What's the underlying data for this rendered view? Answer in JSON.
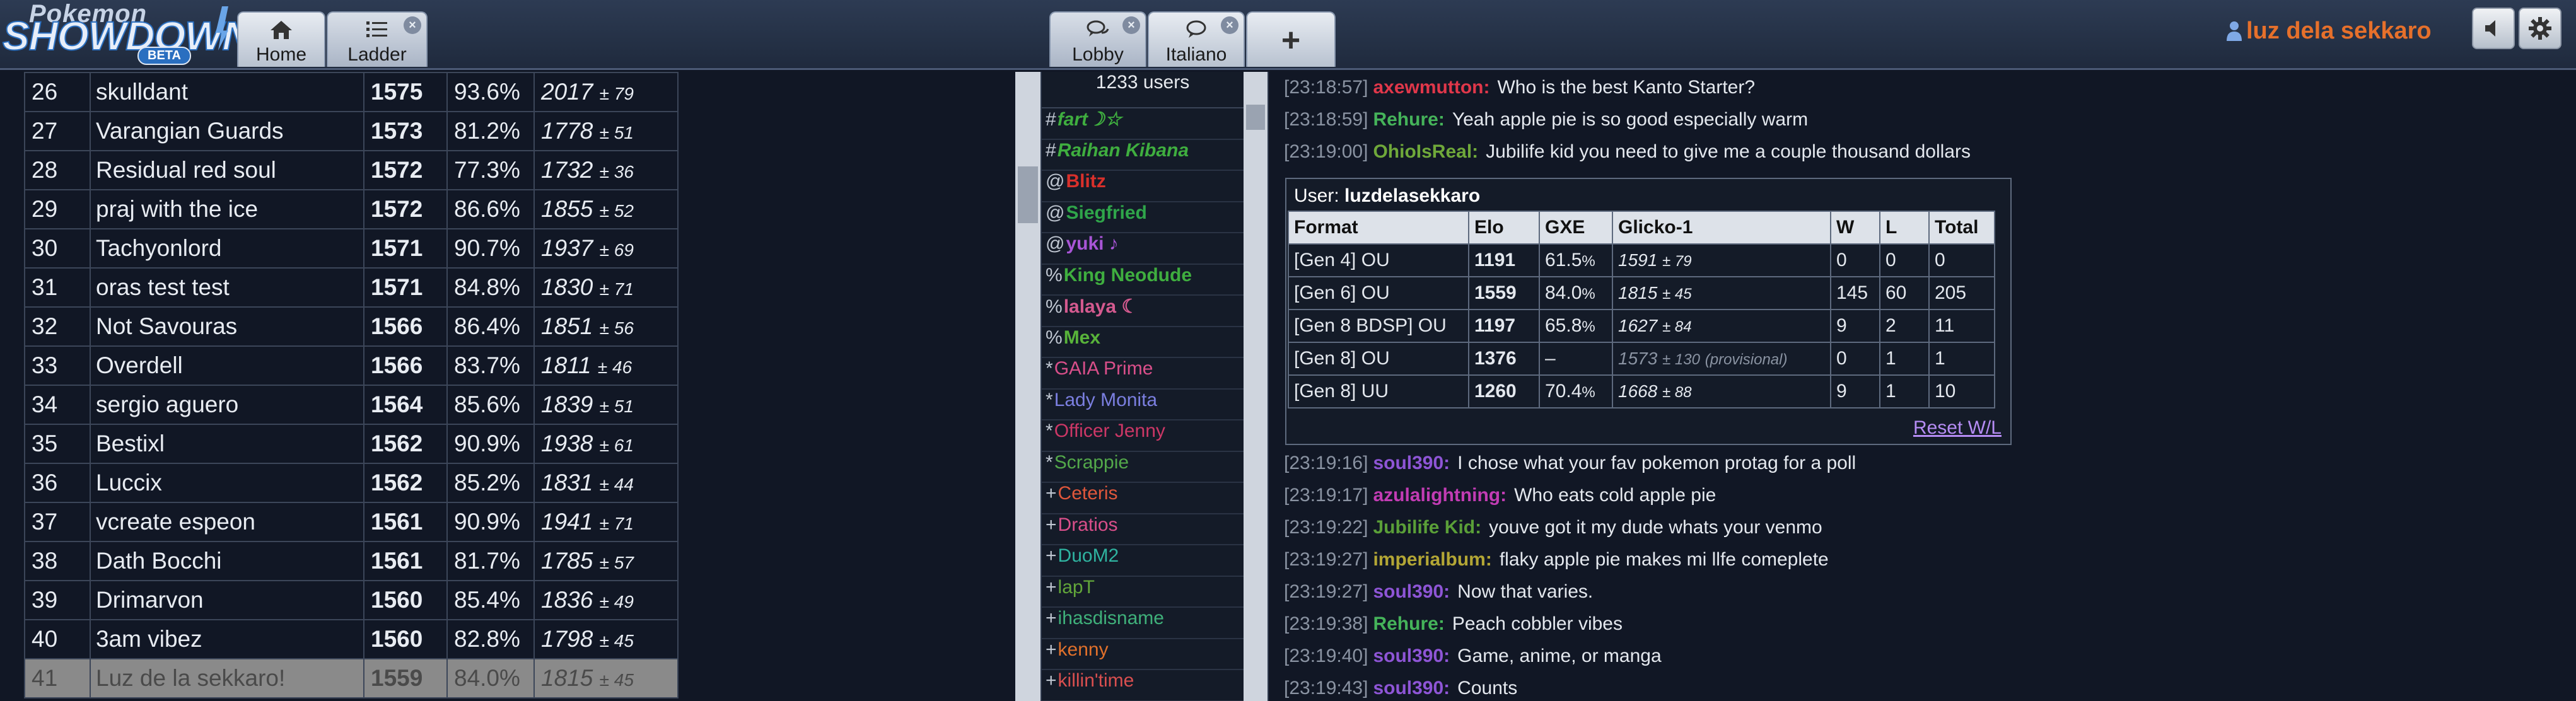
{
  "header": {
    "logo_top": "Pokemon",
    "logo_main": "SHOWDOWN",
    "logo_badge": "BETA",
    "tabs": [
      {
        "label": "Home",
        "icon": "home-icon"
      },
      {
        "label": "Ladder",
        "icon": "list-icon",
        "close": "×"
      },
      {
        "label": "Lobby",
        "icon": "chat-bubbles-icon",
        "close": "×"
      },
      {
        "label": "Italiano",
        "icon": "chat-bubble-icon",
        "close": "×"
      },
      {
        "label": "+",
        "icon": "plus-icon"
      }
    ],
    "username": "luz dela sekkaro"
  },
  "ladder": {
    "rows": [
      {
        "rank": "26",
        "name": "skulldant",
        "elo": "1575",
        "gxe": "93.6%",
        "glicko": "2017",
        "dev": "± 79"
      },
      {
        "rank": "27",
        "name": "Varangian Guards",
        "elo": "1573",
        "gxe": "81.2%",
        "glicko": "1778",
        "dev": "± 51"
      },
      {
        "rank": "28",
        "name": "Residual red soul",
        "elo": "1572",
        "gxe": "77.3%",
        "glicko": "1732",
        "dev": "± 36"
      },
      {
        "rank": "29",
        "name": "praj with the ice",
        "elo": "1572",
        "gxe": "86.6%",
        "glicko": "1855",
        "dev": "± 52"
      },
      {
        "rank": "30",
        "name": "Tachyonlord",
        "elo": "1571",
        "gxe": "90.7%",
        "glicko": "1937",
        "dev": "± 69"
      },
      {
        "rank": "31",
        "name": "oras test test",
        "elo": "1571",
        "gxe": "84.8%",
        "glicko": "1830",
        "dev": "± 71"
      },
      {
        "rank": "32",
        "name": "Not Savouras",
        "elo": "1566",
        "gxe": "86.4%",
        "glicko": "1851",
        "dev": "± 56"
      },
      {
        "rank": "33",
        "name": "Overdell",
        "elo": "1566",
        "gxe": "83.7%",
        "glicko": "1811",
        "dev": "± 46"
      },
      {
        "rank": "34",
        "name": "sergio aguero",
        "elo": "1564",
        "gxe": "85.6%",
        "glicko": "1839",
        "dev": "± 51"
      },
      {
        "rank": "35",
        "name": "Bestixl",
        "elo": "1562",
        "gxe": "90.9%",
        "glicko": "1938",
        "dev": "± 61"
      },
      {
        "rank": "36",
        "name": "Luccix",
        "elo": "1562",
        "gxe": "85.2%",
        "glicko": "1831",
        "dev": "± 44"
      },
      {
        "rank": "37",
        "name": "vcreate espeon",
        "elo": "1561",
        "gxe": "90.9%",
        "glicko": "1941",
        "dev": "± 71"
      },
      {
        "rank": "38",
        "name": "Dath Bocchi",
        "elo": "1561",
        "gxe": "81.7%",
        "glicko": "1785",
        "dev": "± 57"
      },
      {
        "rank": "39",
        "name": "Drimarvon",
        "elo": "1560",
        "gxe": "85.4%",
        "glicko": "1836",
        "dev": "± 49"
      },
      {
        "rank": "40",
        "name": "3am vibez",
        "elo": "1560",
        "gxe": "82.8%",
        "glicko": "1798",
        "dev": "± 45"
      },
      {
        "rank": "41",
        "name": "Luz de la sekkaro!",
        "elo": "1559",
        "gxe": "84.0%",
        "glicko": "1815",
        "dev": "± 45"
      }
    ]
  },
  "userlist": {
    "count": "1233 users",
    "users": [
      {
        "group": "#",
        "name": "fart☽☆",
        "color": "#3fae3f",
        "style": "auth"
      },
      {
        "group": "#",
        "name": "Raihan Kibana",
        "color": "#3fae3f",
        "style": "auth"
      },
      {
        "group": "@",
        "name": "Blitz",
        "color": "#d9302b",
        "style": "staff"
      },
      {
        "group": "@",
        "name": "Siegfried",
        "color": "#2fa54a",
        "style": "staff"
      },
      {
        "group": "@",
        "name": "yuki ♪",
        "color": "#a855d6",
        "style": "staff"
      },
      {
        "group": "%",
        "name": "King Neodude",
        "color": "#3fae3f",
        "style": "staff"
      },
      {
        "group": "%",
        "name": "lalaya ☾",
        "color": "#d45a8f",
        "style": "staff"
      },
      {
        "group": "%",
        "name": "Mex",
        "color": "#58b33a",
        "style": "staff"
      },
      {
        "group": "*",
        "name": "GAIA Prime",
        "color": "#d94f8a",
        "style": "normal"
      },
      {
        "group": "*",
        "name": "Lady Monita",
        "color": "#7b7fe0",
        "style": "normal"
      },
      {
        "group": "*",
        "name": "Officer Jenny",
        "color": "#cc3766",
        "style": "normal"
      },
      {
        "group": "*",
        "name": "Scrappie",
        "color": "#53a84a",
        "style": "normal"
      },
      {
        "group": "+",
        "name": "Ceteris",
        "color": "#e0573b",
        "style": "normal"
      },
      {
        "group": "+",
        "name": "Dratios",
        "color": "#d94f8a",
        "style": "normal"
      },
      {
        "group": "+",
        "name": "DuoM2",
        "color": "#2fb3a0",
        "style": "normal"
      },
      {
        "group": "+",
        "name": "lapT",
        "color": "#62a63a",
        "style": "normal"
      },
      {
        "group": "+",
        "name": "ihasdisname",
        "color": "#3fb07a",
        "style": "normal"
      },
      {
        "group": "+",
        "name": "kenny",
        "color": "#e0702b",
        "style": "normal"
      },
      {
        "group": "+",
        "name": "killin'time",
        "color": "#d94f4f",
        "style": "normal"
      }
    ]
  },
  "chat": {
    "messages_top": [
      {
        "ts": "[23:18:57]",
        "user": "axewmutton:",
        "color": "#e0374a",
        "text": "Who is the best Kanto Starter?"
      },
      {
        "ts": "[23:18:59]",
        "user": "Rehure:",
        "color": "#45b35a",
        "text": "Yeah apple pie is so good especially warm"
      },
      {
        "ts": "[23:19:00]",
        "user": "OhioIsReal:",
        "color": "#6fa83a",
        "text": "Jubilife kid you need to give me a couple thousand dollars"
      }
    ],
    "userdetails": {
      "label": "User:",
      "user": "luzdelasekkaro",
      "headers": [
        "Format",
        "Elo",
        "GXE",
        "Glicko-1",
        "W",
        "L",
        "Total"
      ],
      "rows": [
        {
          "format": "[Gen 4] OU",
          "elo": "1191",
          "gxe": "61.5",
          "pct": "%",
          "glicko": "1591",
          "dev": "± 79",
          "prov": "",
          "w": "0",
          "l": "0",
          "total": "0"
        },
        {
          "format": "[Gen 6] OU",
          "elo": "1559",
          "gxe": "84.0",
          "pct": "%",
          "glicko": "1815",
          "dev": "± 45",
          "prov": "",
          "w": "145",
          "l": "60",
          "total": "205"
        },
        {
          "format": "[Gen 8 BDSP] OU",
          "elo": "1197",
          "gxe": "65.8",
          "pct": "%",
          "glicko": "1627",
          "dev": "± 84",
          "prov": "",
          "w": "9",
          "l": "2",
          "total": "11"
        },
        {
          "format": "[Gen 8] OU",
          "elo": "1376",
          "gxe": "–",
          "pct": "",
          "glicko": "1573",
          "dev": "± 130",
          "prov": "(provisional)",
          "w": "0",
          "l": "1",
          "total": "1"
        },
        {
          "format": "[Gen 8] UU",
          "elo": "1260",
          "gxe": "70.4",
          "pct": "%",
          "glicko": "1668",
          "dev": "± 88",
          "prov": "",
          "w": "9",
          "l": "1",
          "total": "10"
        }
      ],
      "reset": "Reset W/L"
    },
    "messages_bottom": [
      {
        "ts": "[23:19:16]",
        "user": "soul390:",
        "color": "#8e55d6",
        "text": "I chose what your fav pokemon protag for a poll"
      },
      {
        "ts": "[23:19:17]",
        "user": "azulalightning:",
        "color": "#c23cb4",
        "text": "Who eats cold apple pie"
      },
      {
        "ts": "[23:19:22]",
        "user": "Jubilife Kid:",
        "color": "#5a9f38",
        "text": "youve got it my dude whats your venmo"
      },
      {
        "ts": "[23:19:27]",
        "user": "imperialbum:",
        "color": "#b3a635",
        "text": "flaky apple pie makes mi llfe comeplete"
      },
      {
        "ts": "[23:19:27]",
        "user": "soul390:",
        "color": "#8e55d6",
        "text": "Now that varies."
      },
      {
        "ts": "[23:19:38]",
        "user": "Rehure:",
        "color": "#45b35a",
        "text": "Peach cobbler vibes"
      },
      {
        "ts": "[23:19:40]",
        "user": "soul390:",
        "color": "#8e55d6",
        "text": "Game, anime, or manga"
      },
      {
        "ts": "[23:19:43]",
        "user": "soul390:",
        "color": "#8e55d6",
        "text": "Counts"
      }
    ]
  }
}
